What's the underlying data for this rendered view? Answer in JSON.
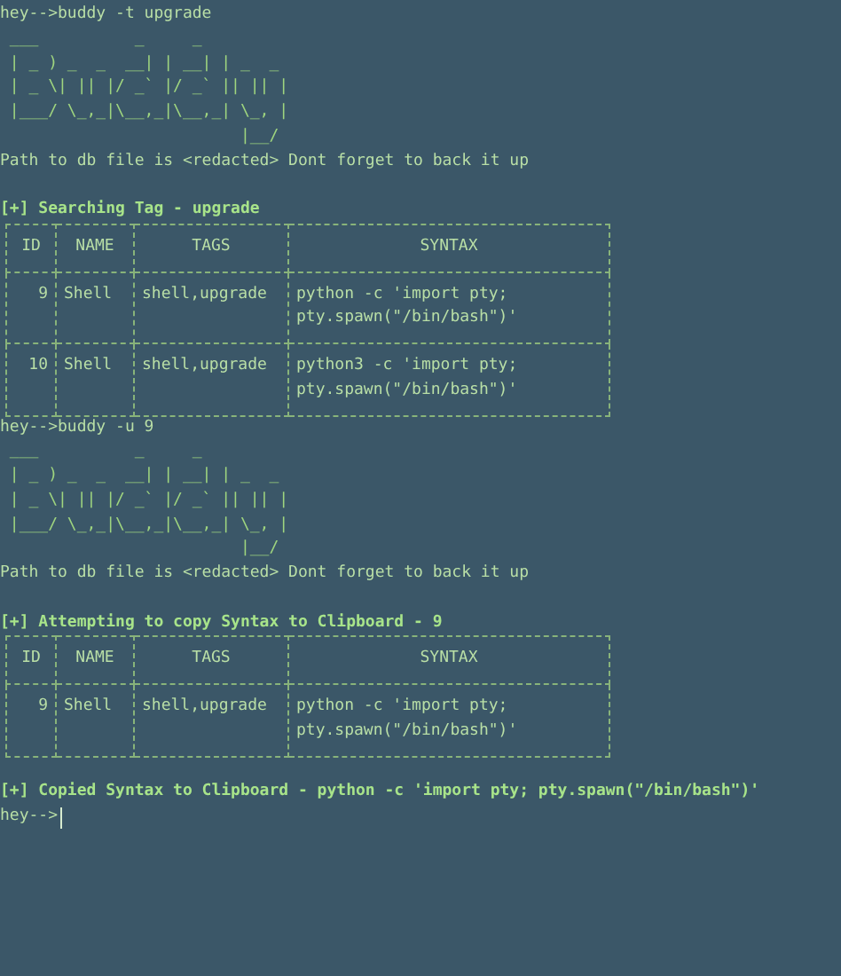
{
  "session": [
    {
      "kind": "command",
      "text": "hey-->buddy -t upgrade"
    },
    {
      "kind": "banner",
      "lines": [
        " ___          _     _",
        " | _ ) _  _  __| | __| | _  _",
        " | _ \\| || |/ _` |/ _` || || |",
        " |___/ \\_,_|\\__,_|\\__,_| \\_, |",
        "                         |__/"
      ]
    },
    {
      "kind": "output",
      "text": "Path to db file is <redacted> Dont forget to back it up"
    },
    {
      "kind": "heading",
      "text": "[+] Searching Tag - upgrade"
    },
    {
      "kind": "table",
      "columns": [
        "ID",
        "NAME",
        "TAGS",
        "SYNTAX"
      ],
      "rows": [
        {
          "cells": [
            [
              "9"
            ],
            [
              "Shell"
            ],
            [
              "shell,upgrade"
            ],
            [
              "python -c 'import pty;",
              "pty.spawn(\"/bin/bash\")'"
            ]
          ]
        },
        {
          "cells": [
            [
              "10"
            ],
            [
              "Shell"
            ],
            [
              "shell,upgrade"
            ],
            [
              "python3 -c 'import pty;",
              "pty.spawn(\"/bin/bash\")'"
            ]
          ]
        }
      ]
    },
    {
      "kind": "command",
      "text": "hey-->buddy -u 9"
    },
    {
      "kind": "banner",
      "lines": [
        " ___          _     _",
        " | _ ) _  _  __| | __| | _  _",
        " | _ \\| || |/ _` |/ _` || || |",
        " |___/ \\_,_|\\__,_|\\__,_| \\_, |",
        "                         |__/"
      ]
    },
    {
      "kind": "output",
      "text": "Path to db file is <redacted> Dont forget to back it up"
    },
    {
      "kind": "heading",
      "text": "[+] Attempting to copy Syntax to Clipboard - 9"
    },
    {
      "kind": "table",
      "columns": [
        "ID",
        "NAME",
        "TAGS",
        "SYNTAX"
      ],
      "rows": [
        {
          "cells": [
            [
              "9"
            ],
            [
              "Shell"
            ],
            [
              "shell,upgrade"
            ],
            [
              "python -c 'import pty;",
              "pty.spawn(\"/bin/bash\")'"
            ]
          ]
        }
      ]
    },
    {
      "kind": "heading",
      "text": "[+] Copied Syntax to Clipboard - python -c 'import pty; pty.spawn(\"/bin/bash\")'"
    },
    {
      "kind": "prompt",
      "text": "hey-->",
      "cursor": true
    }
  ]
}
